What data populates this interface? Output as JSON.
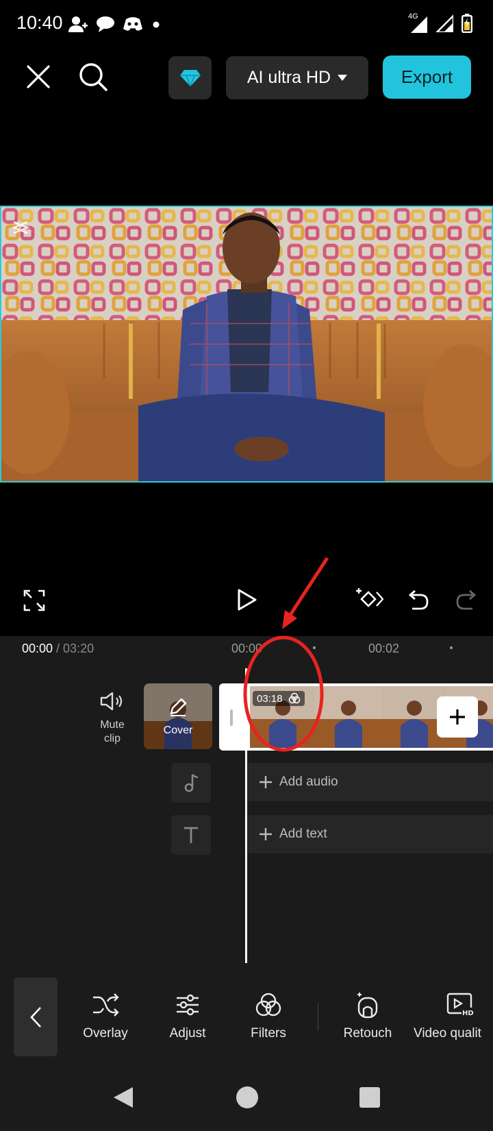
{
  "status_bar": {
    "time": "10:40",
    "network": "4G"
  },
  "toolbar_top": {
    "close_icon": "close-icon",
    "search_icon": "search-icon",
    "pro_icon": "diamond-icon",
    "quality_label": "AI ultra HD",
    "export_label": "Export"
  },
  "colors": {
    "accent": "#21c4dc",
    "annotation_red": "#e8231f",
    "background": "#000000",
    "panel": "#1b1b1b"
  },
  "preview": {
    "watermark_icon": "capcut-logo-icon"
  },
  "controls": {
    "fullscreen_icon": "fullscreen-icon",
    "play_icon": "play-icon",
    "keyframe_icon": "keyframe-icon",
    "undo_icon": "undo-icon",
    "redo_icon": "redo-icon"
  },
  "timeline": {
    "current_time": "00:00",
    "total_time": " / 03:20",
    "ruler_labels": [
      "00:00",
      "00:02"
    ],
    "mute_label": "Mute clip",
    "cover_label": "Cover",
    "clip_duration": "03:18",
    "add_audio_label": "Add audio",
    "add_text_label": "Add text"
  },
  "bottom_tools": [
    {
      "label": "Overlay",
      "icon": "shuffle-icon"
    },
    {
      "label": "Adjust",
      "icon": "sliders-icon"
    },
    {
      "label": "Filters",
      "icon": "filters-icon"
    },
    {
      "label": "Retouch",
      "icon": "retouch-icon"
    },
    {
      "label": "Video qualit",
      "icon": "video-hd-icon"
    }
  ],
  "nav": {
    "back": "nav-back-icon",
    "home": "nav-home-icon",
    "recents": "nav-recents-icon"
  }
}
